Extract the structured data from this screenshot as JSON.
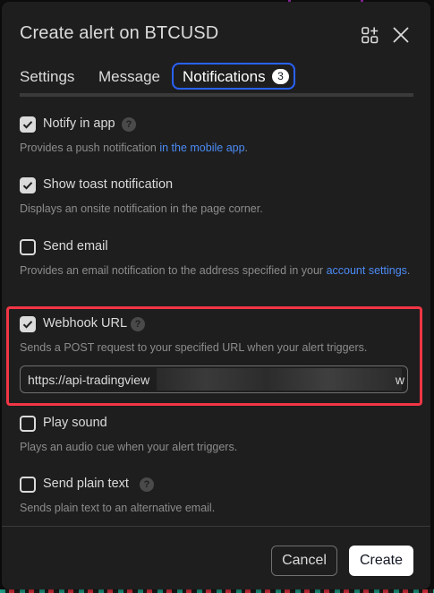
{
  "dialog": {
    "title": "Create alert on BTCUSD",
    "icons": [
      "add-widget-icon",
      "close-icon"
    ]
  },
  "tabs": [
    {
      "label": "Settings"
    },
    {
      "label": "Message"
    },
    {
      "label": "Notifications",
      "badge": "3",
      "active": true
    }
  ],
  "options": {
    "notify_in_app": {
      "label": "Notify in app",
      "checked": true,
      "help": "?",
      "desc_prefix": "Provides a push notification ",
      "desc_link": "in the mobile app",
      "desc_suffix": "."
    },
    "toast": {
      "label": "Show toast notification",
      "checked": true,
      "desc": "Displays an onsite notification in the page corner."
    },
    "email": {
      "label": "Send email",
      "checked": false,
      "desc_prefix": "Provides an email notification to the address specified in your ",
      "desc_link": "account settings",
      "desc_suffix": "."
    },
    "webhook": {
      "label": "Webhook URL",
      "checked": true,
      "help": "?",
      "desc": "Sends a POST request to your specified URL when your alert triggers.",
      "url_value_visible": "https://api-tradingview",
      "url_tail": "w"
    },
    "sound": {
      "label": "Play sound",
      "checked": false,
      "desc": "Plays an audio cue when your alert triggers."
    },
    "plain_text": {
      "label": "Send plain text",
      "checked": false,
      "help": "?",
      "desc": "Sends plain text to an alternative email."
    }
  },
  "footer": {
    "cancel_label": "Cancel",
    "create_label": "Create"
  },
  "colors": {
    "accent": "#2962ff",
    "highlight": "#f23645",
    "link": "#4c8bf5"
  }
}
